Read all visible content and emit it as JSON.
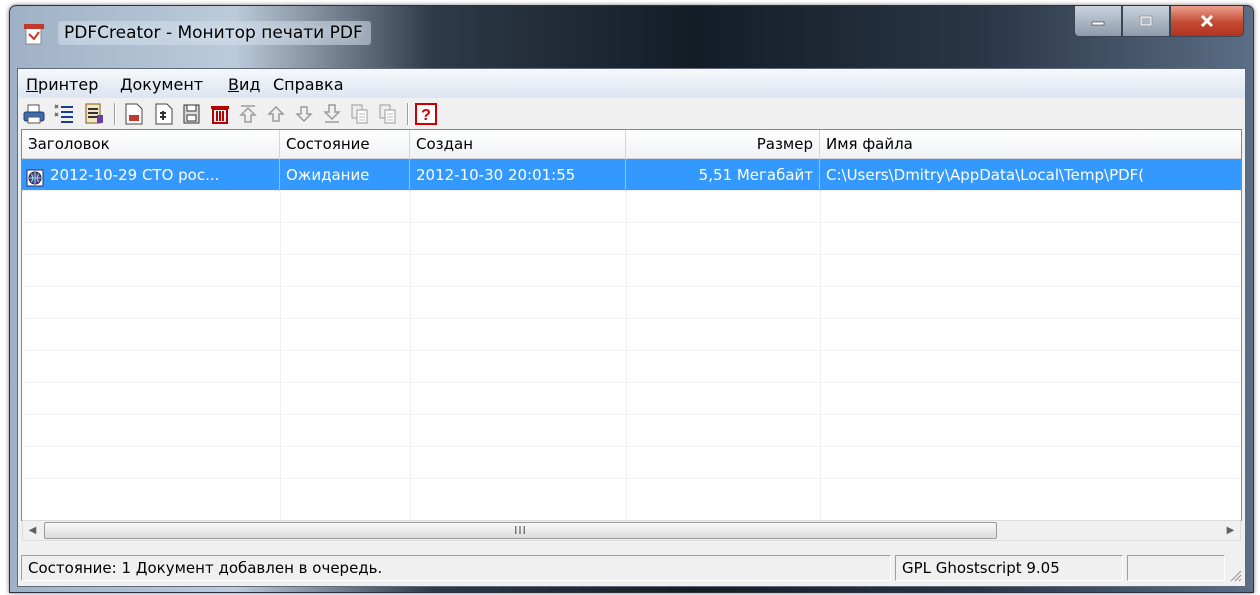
{
  "window": {
    "title": "PDFCreator - Монитор печати PDF"
  },
  "window_buttons": [
    {
      "name": "minimize-button",
      "icon": "minimize-icon"
    },
    {
      "name": "maximize-button",
      "icon": "maximize-icon"
    },
    {
      "name": "close-button",
      "icon": "close-icon"
    }
  ],
  "menu": [
    {
      "label": "Принтер",
      "hotkey": "П",
      "rest": "ринтер"
    },
    {
      "label": "Документ",
      "hotkey": "Д",
      "rest": "окумент"
    },
    {
      "label": "Вид",
      "hotkey": "В",
      "rest": "ид"
    },
    {
      "label": "Справка",
      "hotkey": "",
      "rest": "Справка"
    }
  ],
  "toolbar": {
    "icons": [
      "printer-icon",
      "printer-settings-icon",
      "document-options-icon",
      "save-document-icon",
      "merge-documents-icon",
      "add-document-icon",
      "delete-icon",
      "move-top-icon",
      "move-up-icon",
      "move-down-icon",
      "move-bottom-icon",
      "copy-icon",
      "paste-icon",
      "help-icon"
    ]
  },
  "list": {
    "columns": [
      "Заголовок",
      "Состояние",
      "Создан",
      "Размер",
      "Имя файла"
    ],
    "rows": [
      {
        "icon": "document-globe-icon",
        "title": "2012-10-29 СТО рос...",
        "status": "Ожидание",
        "created": "2012-10-30 20:01:55",
        "size": "5,51 Мегабайт",
        "filename": "C:\\Users\\Dmitry\\AppData\\Local\\Temp\\PDF("
      }
    ]
  },
  "scrollbar": {
    "thumb_grip": "III"
  },
  "statusbar": {
    "status": "Состояние: 1 Документ добавлен в очередь.",
    "engine": "GPL Ghostscript 9.05",
    "extra": ""
  },
  "colors": {
    "selection": "#3399ff",
    "menubar": "#dce5f1",
    "client": "#f0f0f0",
    "close_button": "#c44a32"
  }
}
